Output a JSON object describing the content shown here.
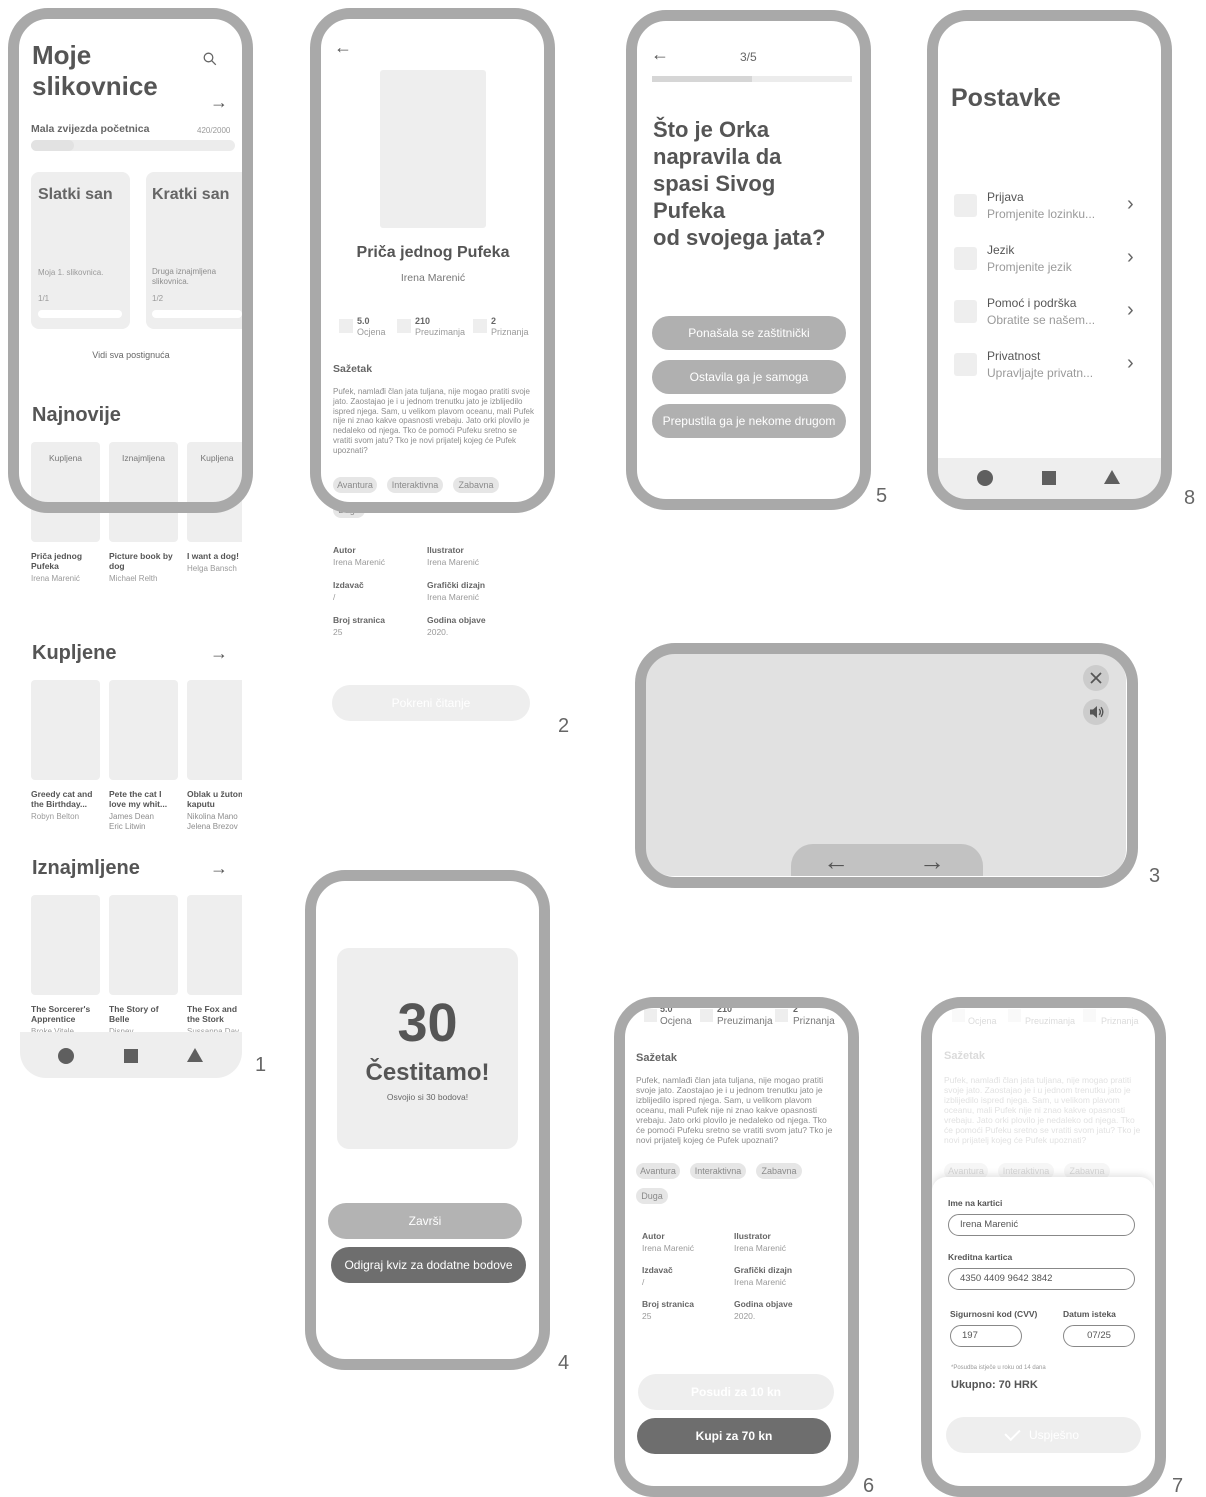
{
  "screen_numbers": [
    "1",
    "2",
    "3",
    "4",
    "5",
    "6",
    "7",
    "8"
  ],
  "s1": {
    "title_line1": "Moje",
    "title_line2": "slikovnice",
    "progress_label": "Mala zvijezda početnica",
    "progress_value": "420/2000",
    "progress_fraction": 0.21,
    "cards": [
      {
        "title": "Slatki san",
        "desc": "Moja 1. slikovnica.",
        "count": "1/1"
      },
      {
        "title": "Kratki san",
        "desc": "Druga iznajmljena slikovnica.",
        "count": "1/2"
      }
    ],
    "see_all": "Vidi sva postignuća",
    "najnovije": {
      "heading": "Najnovije",
      "items": [
        {
          "tag": "Kupljena",
          "title": "Priča jednog Pufeka",
          "author": "Irena Marenić"
        },
        {
          "tag": "Iznajmljena",
          "title": "Picture book by dog",
          "author": "Michael Relth"
        },
        {
          "tag": "Kupljena",
          "title": "I want a dog!",
          "author": "Helga Bansch"
        }
      ]
    },
    "kupljene": {
      "heading": "Kupljene",
      "items": [
        {
          "title": "Greedy cat and the Birthday...",
          "author": "Robyn Belton"
        },
        {
          "title": "Pete the cat I love my whit...",
          "author": "James Dean Eric Litwin"
        },
        {
          "title": "Oblak u žutom kaputu",
          "author": "Nikolina Mano Jelena Brezov"
        }
      ]
    },
    "iznajmljene": {
      "heading": "Iznajmljene",
      "items": [
        {
          "title": "The Sorcerer's Apprentice",
          "author": "Broke Vitale"
        },
        {
          "title": "The Story of Belle",
          "author": "Disney"
        },
        {
          "title": "The Fox and the Stork",
          "author": "Sussanna Dav"
        }
      ]
    }
  },
  "book": {
    "title": "Priča jednog Pufeka",
    "author": "Irena Marenić",
    "stats": [
      {
        "value": "5.0",
        "label": "Ocjena"
      },
      {
        "value": "210",
        "label": "Preuzimanja"
      },
      {
        "value": "2",
        "label": "Priznanja"
      }
    ],
    "summary_heading": "Sažetak",
    "summary": "Pufek, namlađi član jata tuljana, nije mogao pratiti svoje jato. Zaostajao je i u jednom trenutku jato je izblijedilo ispred njega. Sam, u velikom plavom oceanu, mali Pufek nije ni znao kakve opasnosti vrebaju. Jato orki plovilo je nedaleko od njega. Tko će pomoći Pufeku sretno se vratiti svom jatu? Tko je novi prijatelj kojeg će Pufek upoznati?",
    "tags": [
      "Avantura",
      "Interaktivna",
      "Zabavna",
      "Duga"
    ],
    "meta": [
      {
        "label": "Autor",
        "value": "Irena Marenić"
      },
      {
        "label": "Ilustrator",
        "value": "Irena Marenić"
      },
      {
        "label": "Izdavač",
        "value": "/"
      },
      {
        "label": "Grafički dizajn",
        "value": "Irena Marenić"
      },
      {
        "label": "Broj stranica",
        "value": "25"
      },
      {
        "label": "Godina objave",
        "value": "2020."
      }
    ],
    "start_button": "Pokreni čitanje"
  },
  "reader": {
    "close_icon": "close-icon",
    "sound_icon": "speaker-icon",
    "prev_arrow": "←",
    "next_arrow": "→"
  },
  "congrats": {
    "points": "30",
    "title": "Čestitamo!",
    "subtitle": "Osvojio si 30 bodova!",
    "finish_button": "Završi",
    "quiz_button": "Odigraj kviz za dodatne bodove"
  },
  "quiz": {
    "step": "3/5",
    "progress_fraction": 0.5,
    "question_lines": [
      "Što je Orka",
      "napravila da",
      "spasi Sivog",
      "Pufeka",
      "od svojega jata?"
    ],
    "answers": [
      "Ponašala se zaštitnički",
      "Ostavila ga je samoga",
      "Prepustila ga je nekome drugom"
    ]
  },
  "buy": {
    "borrow_button": "Posudi za 10 kn",
    "buy_button": "Kupi za 70 kn"
  },
  "payment": {
    "name_label": "Ime na kartici",
    "name_value": "Irena Marenić",
    "card_label": "Kreditna kartica",
    "card_value": "4350 4409 9642 3842",
    "cvv_label": "Sigurnosni kod (CVV)",
    "cvv_value": "197",
    "expiry_label": "Datum isteka",
    "expiry_value": "07/25",
    "note": "*Posudba istječe u roku od 14 dana",
    "total": "Ukupno: 70 HRK",
    "success_button": "Uspješno"
  },
  "settings": {
    "title": "Postavke",
    "items": [
      {
        "title": "Prijava",
        "subtitle": "Promjenite lozinku..."
      },
      {
        "title": "Jezik",
        "subtitle": "Promjenite jezik"
      },
      {
        "title": "Pomoć i podrška",
        "subtitle": "Obratite se našem..."
      },
      {
        "title": "Privatnost",
        "subtitle": "Upravljajte privatn..."
      }
    ]
  }
}
